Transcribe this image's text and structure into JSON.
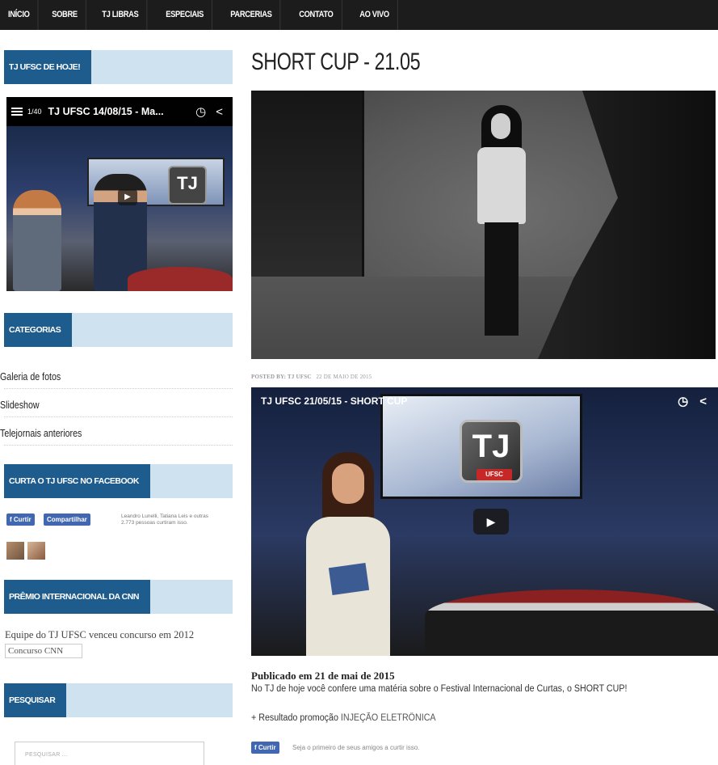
{
  "nav": {
    "items": [
      "INÍCIO",
      "SOBRE",
      "TJ LIBRAS",
      "ESPECIAIS",
      "PARCERIAS",
      "CONTATO",
      "AO VIVO"
    ]
  },
  "sidebar": {
    "tj_today": {
      "heading": "TJ UFSC DE HOJE!",
      "video": {
        "playlist_count": "1/40",
        "title": "TJ UFSC 14/08/15 - Ma...",
        "logo_text": "TJ",
        "play_icon": "play-icon",
        "watch_later_icon": "clock-icon",
        "share_icon": "share-icon"
      }
    },
    "categories": {
      "heading": "CATEGORIAS",
      "items": [
        "Galeria de fotos",
        "Slideshow",
        "Telejornais anteriores"
      ]
    },
    "facebook": {
      "heading": "CURTA O TJ UFSC NO FACEBOOK",
      "like_label": "Curtir",
      "share_label": "Compartilhar",
      "social_text": "Leandro Lunelli, Tatiana Leis e outras 2.773 pessoas curtiram isso.",
      "brand_color": "#4267b2"
    },
    "cnn": {
      "heading": "PRÊMIO INTERNACIONAL DA CNN",
      "text": "Equipe do TJ UFSC venceu concurso em 2012",
      "image_alt": "Concurso CNN"
    },
    "search": {
      "heading": "PESQUISAR",
      "placeholder": "PESQUISAR ..."
    },
    "accent_color": "#1f5c8e",
    "head_bg_color": "#cfe2f0"
  },
  "post": {
    "title": "SHORT CUP - 21.05",
    "byline_label": "POSTED BY: TJ UFSC",
    "byline_date": "22 DE MAIO DE 2015",
    "video": {
      "title": "TJ UFSC 21/05/15 - SHORT CUP",
      "logo_text": "TJ",
      "logo_sub": "UFSC",
      "play_icon": "play-icon",
      "watch_later_icon": "clock-icon",
      "share_icon": "share-icon"
    },
    "published": "Publicado em 21 de mai de 2015",
    "body": "No TJ de hoje você confere uma matéria sobre o Festival Internacional de Curtas, o SHORT CUP!",
    "promo_prefix": "+ Resultado promoção ",
    "promo_highlight": "INJEÇÃO ELETRÔNICA",
    "like_label": "Curtir",
    "like_text": "Seja o primeiro de seus amigos a curtir isso."
  }
}
